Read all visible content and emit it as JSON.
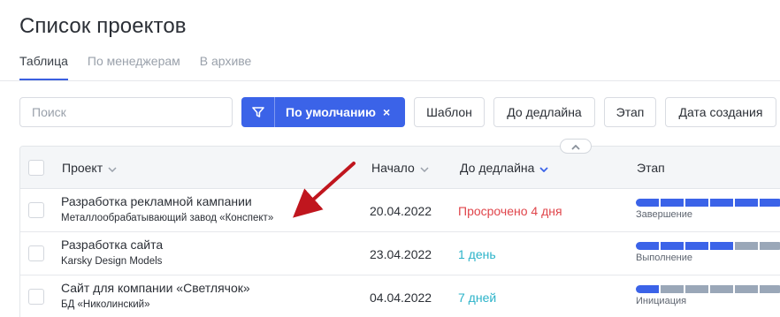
{
  "page": {
    "title": "Список проектов"
  },
  "tabs": [
    {
      "label": "Таблица",
      "active": true
    },
    {
      "label": "По менеджерам",
      "active": false
    },
    {
      "label": "В архиве",
      "active": false
    }
  ],
  "toolbar": {
    "search_placeholder": "Поиск",
    "filter_label": "По умолчанию",
    "filter_close": "×",
    "chips": [
      "Шаблон",
      "До дедлайна",
      "Этап",
      "Дата создания"
    ]
  },
  "table": {
    "columns": {
      "project": "Проект",
      "start": "Начало",
      "deadline": "До дедлайна",
      "stage": "Этап"
    },
    "rows": [
      {
        "title": "Разработка рекламной кампании",
        "client": "Металлообрабатывающий завод «Конспект»",
        "start": "20.04.2022",
        "deadline": "Просрочено 4 дня",
        "deadline_color": "#e0454b",
        "stage": "Завершение",
        "stage_filled": 6
      },
      {
        "title": "Разработка сайта",
        "client": "Karsky Design Models",
        "start": "23.04.2022",
        "deadline": "1 день",
        "deadline_color": "#2bb3c9",
        "stage": "Выполнение",
        "stage_filled": 4
      },
      {
        "title": "Сайт для компании «Светлячок»",
        "client": "БД «Николинский»",
        "start": "04.04.2022",
        "deadline": "7 дней",
        "deadline_color": "#2bb3c9",
        "stage": "Инициация",
        "stage_filled": 1
      }
    ],
    "stage_segments": 6
  },
  "colors": {
    "accent": "#3b63e8",
    "overdue": "#e0454b",
    "ok": "#2bb3c9",
    "arrow": "#c0161e"
  }
}
